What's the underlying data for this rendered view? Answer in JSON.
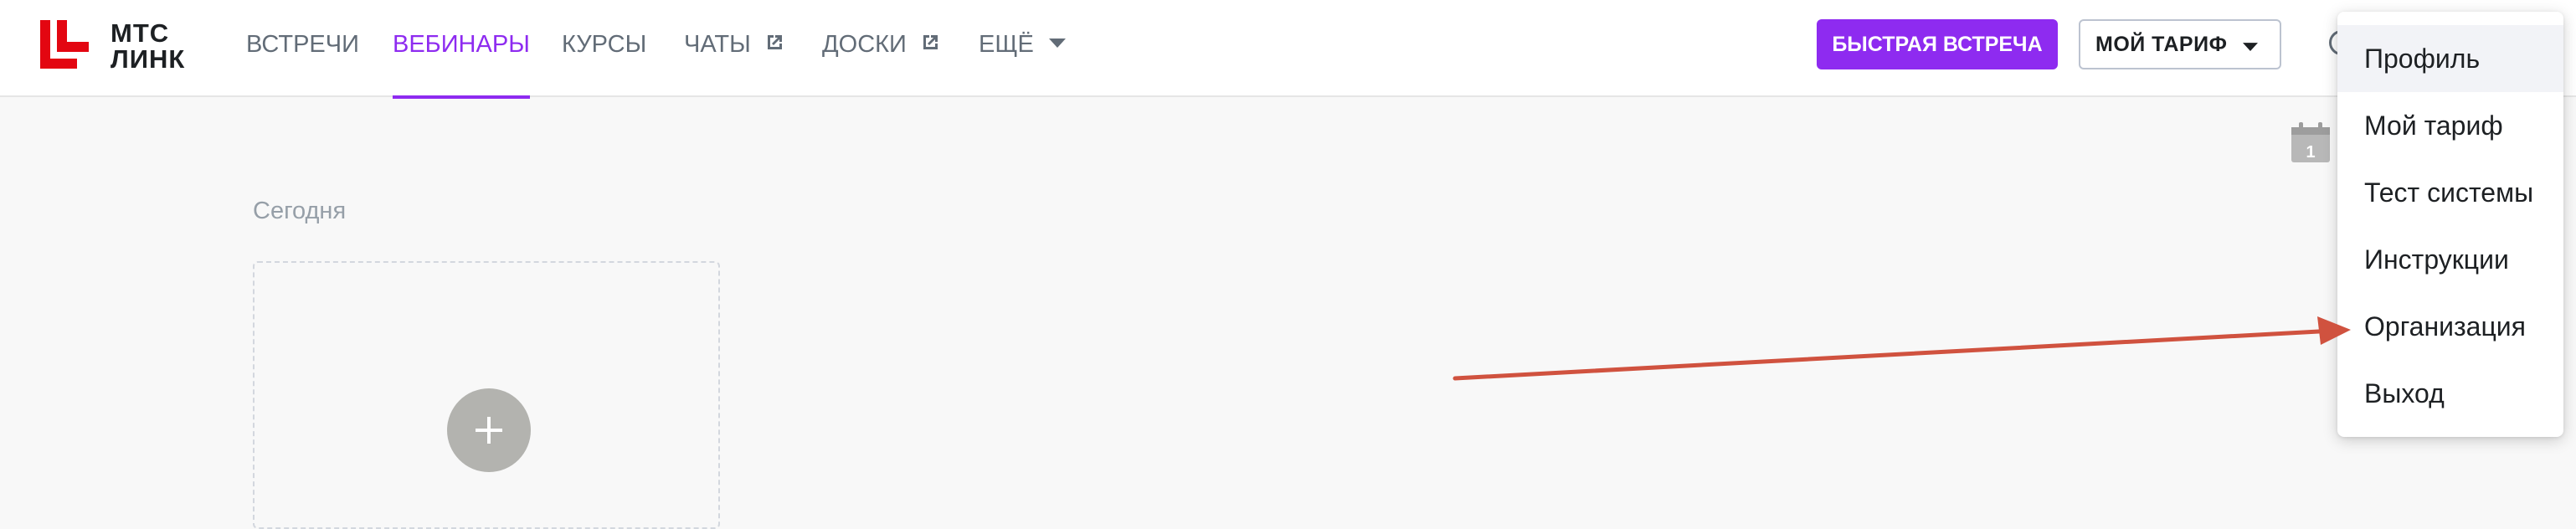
{
  "brand": {
    "name_line1": "МТС",
    "name_line2": "ЛИНК",
    "color": "#e30611"
  },
  "nav": {
    "items": [
      {
        "label": "ВСТРЕЧИ",
        "active": false
      },
      {
        "label": "ВЕБИНАРЫ",
        "active": true
      },
      {
        "label": "КУРСЫ",
        "active": false
      },
      {
        "label": "ЧАТЫ",
        "active": false,
        "icon": "external-link-icon"
      },
      {
        "label": "ДОСКИ",
        "active": false,
        "icon": "external-link-icon"
      },
      {
        "label": "ЕЩЁ",
        "active": false,
        "icon": "caret-down-icon"
      }
    ],
    "active_color": "#8e2bf0"
  },
  "header": {
    "quick_meeting_label": "БЫСТРАЯ ВСТРЕЧА",
    "tariff_label": "МОЙ ТАРИФ",
    "tariff_icon": "caret-down-icon",
    "calendar_icon": "calendar-icon",
    "calendar_day": "1"
  },
  "main": {
    "section_title": "Сегодня",
    "create_card_icon": "plus-icon"
  },
  "user_menu": {
    "items": [
      {
        "label": "Профиль",
        "highlighted": true
      },
      {
        "label": "Мой тариф"
      },
      {
        "label": "Тест системы"
      },
      {
        "label": "Инструкции"
      },
      {
        "label": "Организация",
        "annotated": true
      },
      {
        "label": "Выход"
      }
    ]
  },
  "annotation": {
    "type": "arrow",
    "color": "#d0523f",
    "target": "Организация"
  }
}
